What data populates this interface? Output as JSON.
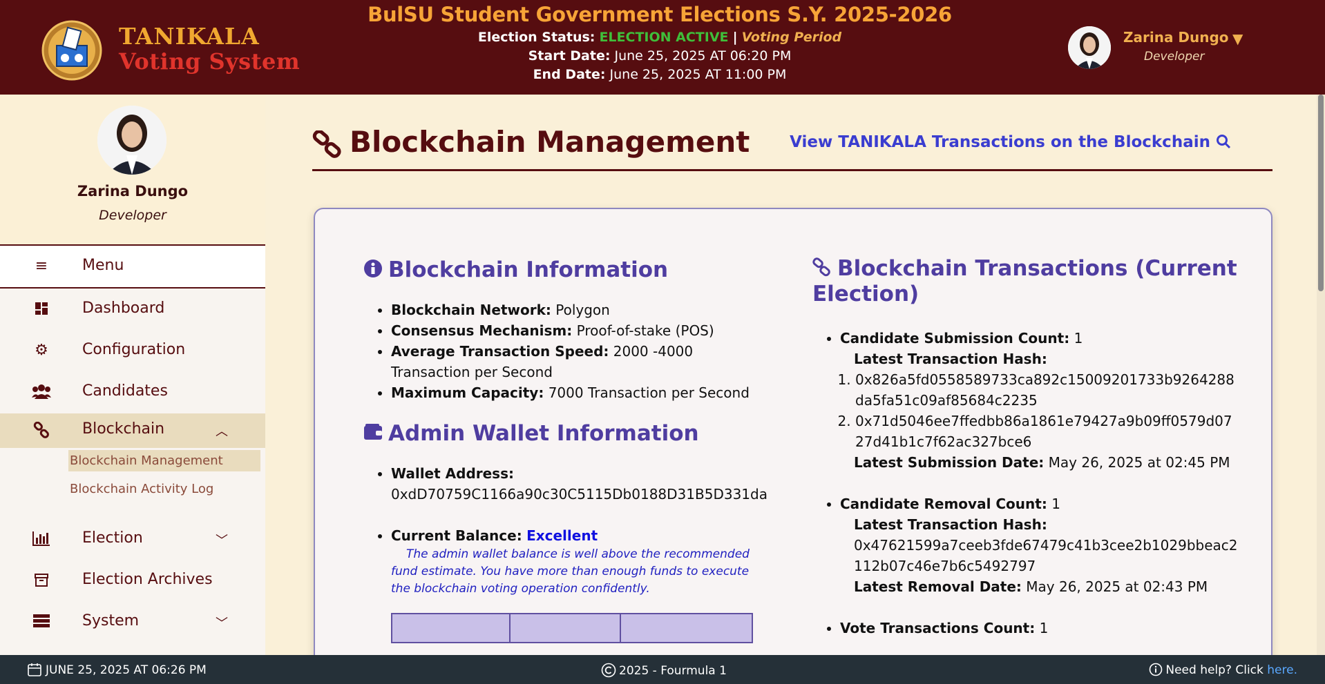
{
  "header": {
    "logo_line1": "TANIKALA",
    "logo_line2": "Voting System",
    "title": "BulSU Student Government Elections S.Y. 2025-2026",
    "status_label": "Election Status:",
    "status_value": "ELECTION ACTIVE",
    "status_sep": "|",
    "status_period": "Voting Period",
    "start_label": "Start Date:",
    "start_value": "June 25, 2025 AT 06:20 PM",
    "end_label": "End Date:",
    "end_value": "June 25, 2025 AT 11:00 PM",
    "user_name": "Zarina Dungo",
    "user_role": "Developer"
  },
  "sidebar": {
    "profile_name": "Zarina Dungo",
    "profile_role": "Developer",
    "menu_label": "Menu",
    "items": [
      {
        "label": "Dashboard",
        "icon": "dashboard-icon"
      },
      {
        "label": "Configuration",
        "icon": "gears-icon"
      },
      {
        "label": "Candidates",
        "icon": "users-icon"
      },
      {
        "label": "Blockchain",
        "icon": "link-icon"
      },
      {
        "label": "Election",
        "icon": "bar-chart-icon"
      },
      {
        "label": "Election Archives",
        "icon": "archive-icon"
      },
      {
        "label": "System",
        "icon": "server-icon"
      }
    ],
    "blockchain_sub": [
      "Blockchain Management",
      "Blockchain Activity Log"
    ]
  },
  "main": {
    "page_title": "Blockchain Management",
    "view_link": "View TANIKALA Transactions on the Blockchain",
    "info": {
      "title": "Blockchain Information",
      "network_label": "Blockchain Network:",
      "network_value": "Polygon",
      "consensus_label": "Consensus Mechanism:",
      "consensus_value": "Proof-of-stake (POS)",
      "speed_label": "Average Transaction Speed:",
      "speed_value": "2000 -4000 Transaction per Second",
      "capacity_label": "Maximum Capacity:",
      "capacity_value": "7000 Transaction per Second"
    },
    "wallet": {
      "title": "Admin Wallet Information",
      "address_label": "Wallet Address:",
      "address_value": "0xdD70759C1166a90c30C5115Db0188D31B5D331da",
      "balance_label": "Current Balance:",
      "balance_value": "Excellent",
      "note": "The admin wallet balance is well above the recommended fund estimate. You have more than enough funds to execute the blockchain voting operation confidently."
    },
    "transactions": {
      "title": "Blockchain Transactions (Current Election)",
      "submission_label": "Candidate Submission Count:",
      "submission_count": "1",
      "latest_hash_label": "Latest Transaction Hash:",
      "submission_hashes": [
        "0x826a5fd0558589733ca892c15009201733b9264288da5fa51c09af85684c2235",
        "0x71d5046ee7ffedbb86a1861e79427a9b09ff0579d0727d41b1c7f62ac327bce6"
      ],
      "submission_date_label": "Latest Submission Date:",
      "submission_date": "May 26, 2025 at 02:45 PM",
      "removal_label": "Candidate Removal Count:",
      "removal_count": "1",
      "removal_hash_label": "Latest Transaction Hash:",
      "removal_hash": "0x47621599a7ceeb3fde67479c41b3cee2b1029bbeac2112b07c46e7b6c5492797",
      "removal_date_label": "Latest Removal Date:",
      "removal_date": "May 26, 2025 at 02:43 PM",
      "vote_label": "Vote Transactions Count:",
      "vote_count": "1"
    }
  },
  "footer": {
    "datetime": "JUNE 25, 2025 AT 06:26 PM",
    "copyright": "2025 - Fourmula 1",
    "help_text": "Need help? Click",
    "help_link": "here."
  }
}
